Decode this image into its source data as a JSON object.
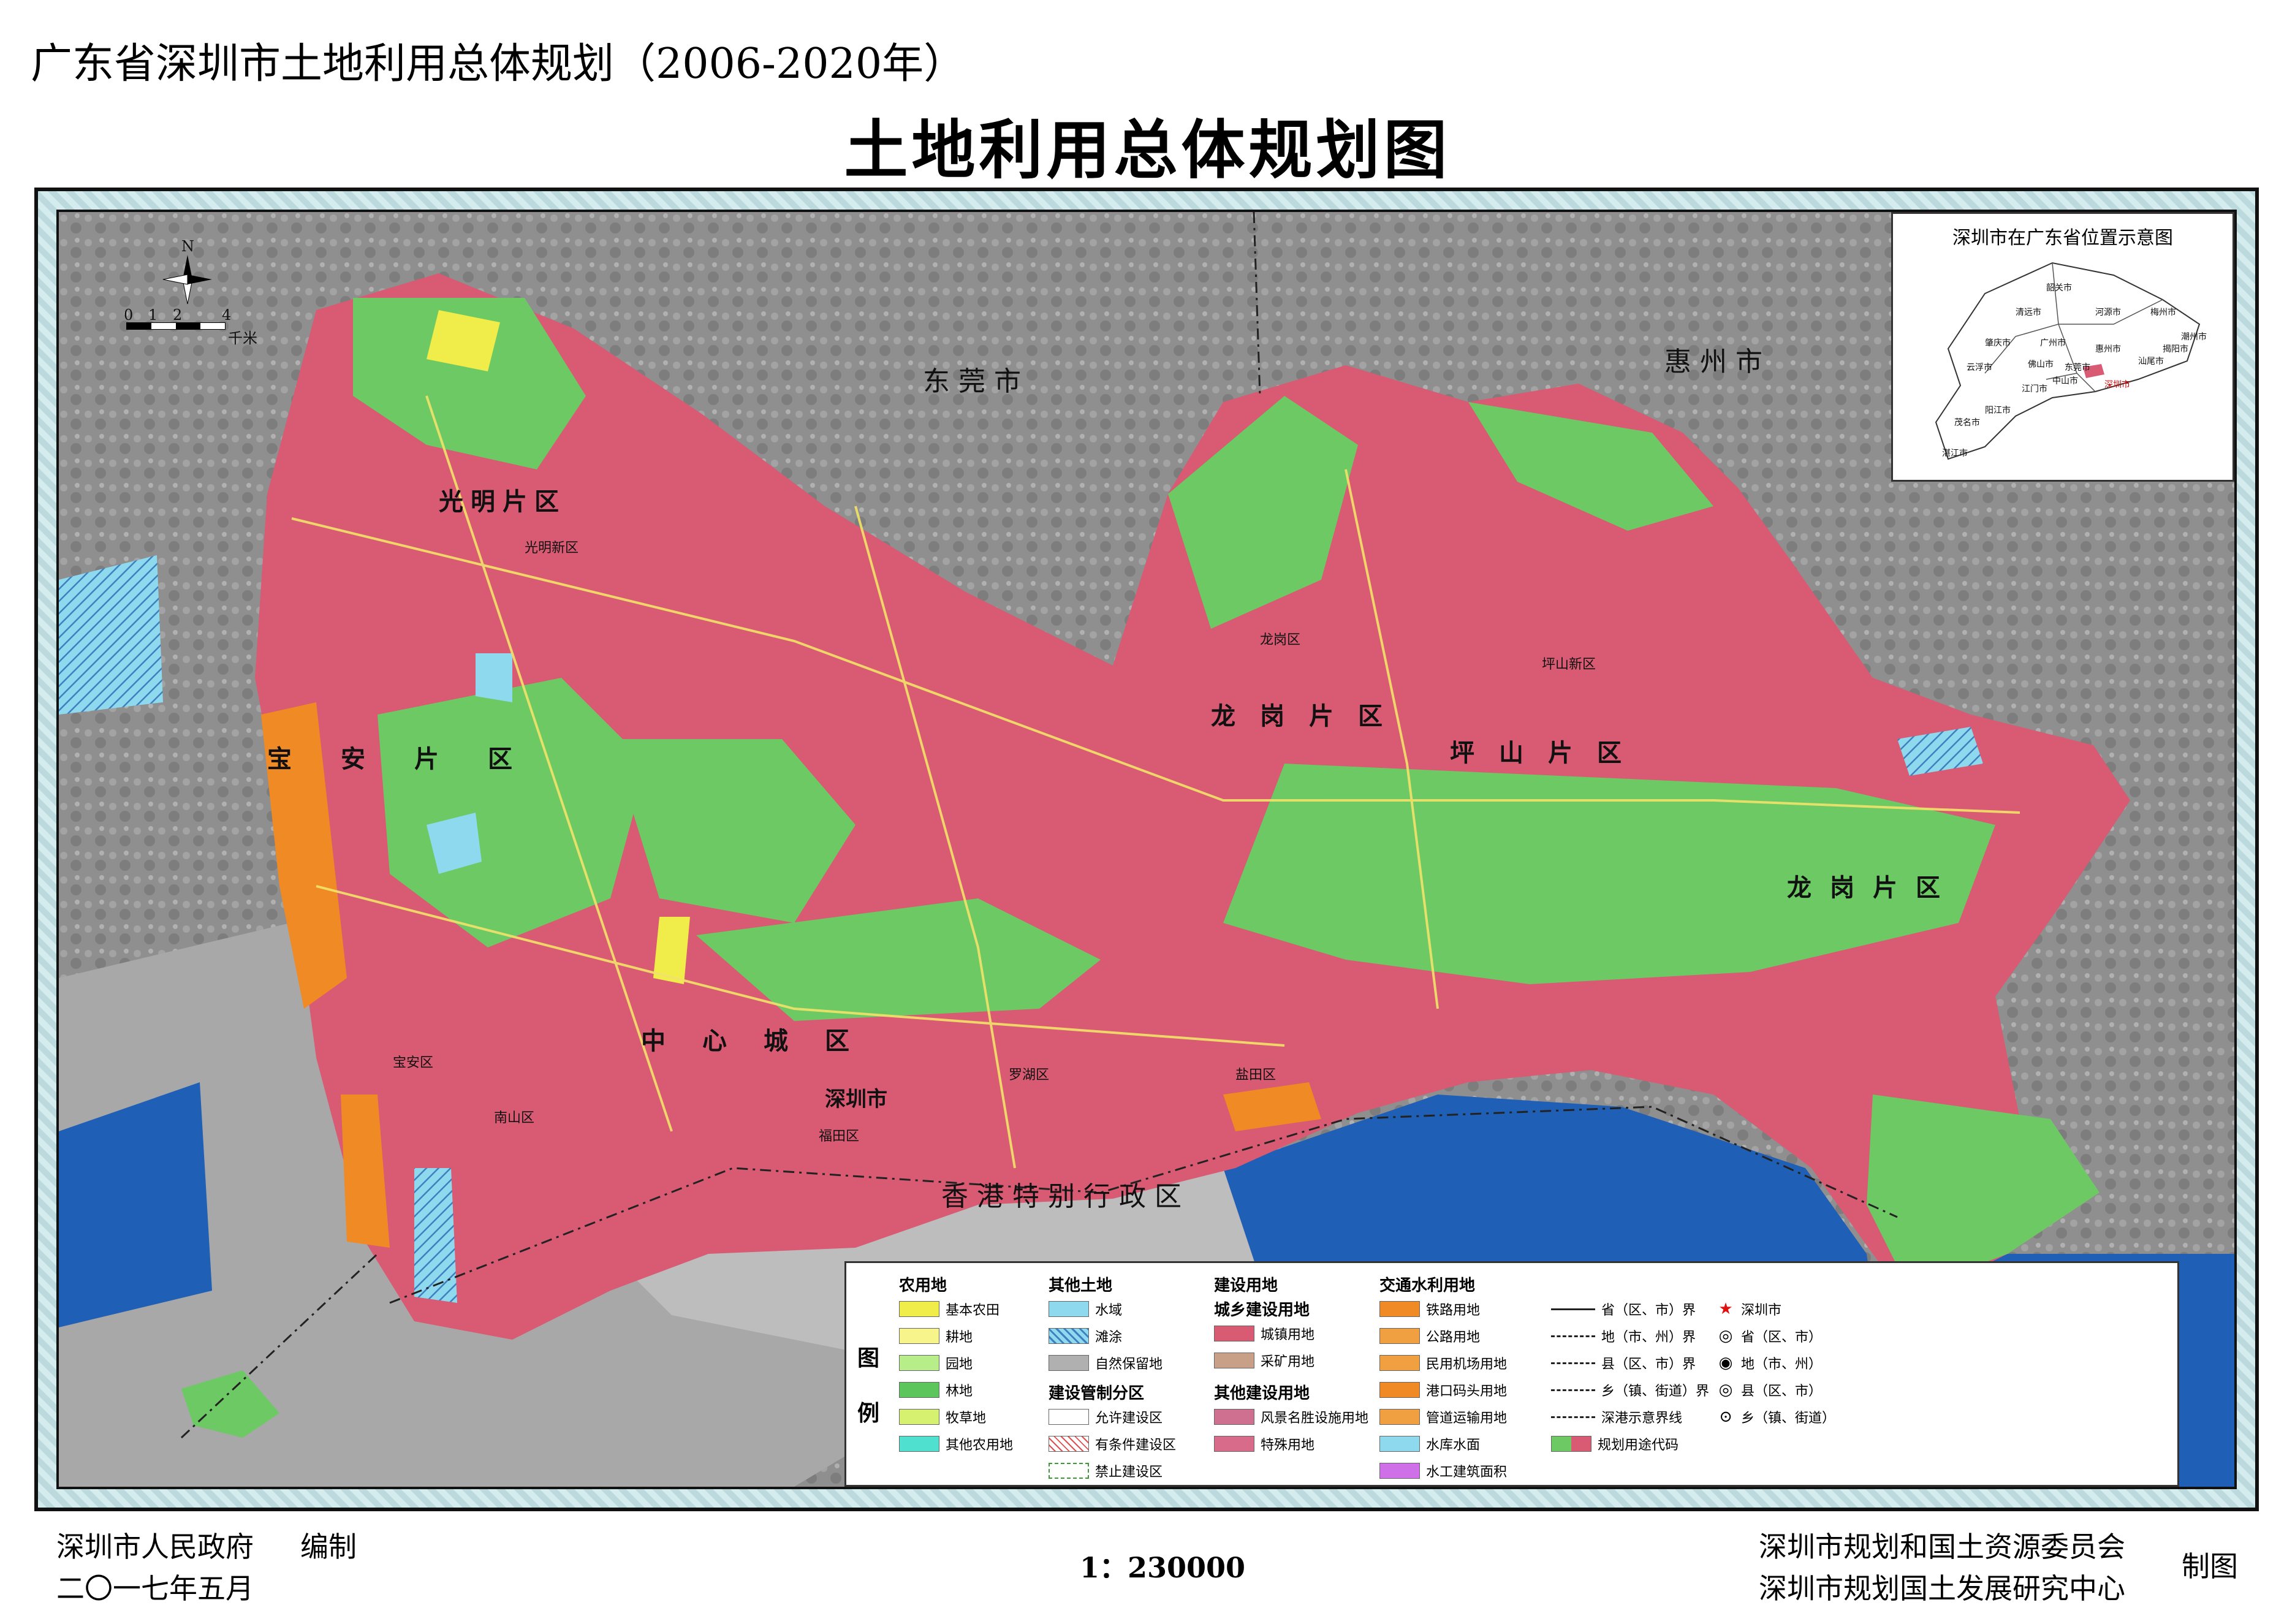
{
  "header": {
    "doc_title": "广东省深圳市土地利用总体规划（2006-2020年）",
    "map_title": "土地利用总体规划图"
  },
  "map": {
    "neighbors": {
      "dongguan": "东莞市",
      "huizhou": "惠州市",
      "hongkong": "香港特别行政区"
    },
    "districts": {
      "guangming": "光明片区",
      "baoan": "宝安片区",
      "longgang_north": "龙岗片区",
      "pingshan": "坪山片区",
      "center": "中心城区",
      "longgang_east": "龙岗片区"
    },
    "towns": {
      "guangming_new": "光明新区",
      "baoan_qu": "宝安区",
      "nanshan": "南山区",
      "futian": "福田区",
      "shenzhen": "深圳市",
      "luohu": "罗湖区",
      "yantian": "盐田区",
      "longgang_qu": "龙岗区",
      "pingshan_new": "坪山新区"
    },
    "compass": {
      "north": "N",
      "scale_ticks": [
        "0",
        "1",
        "2",
        "4"
      ],
      "scale_unit": "千米"
    },
    "colors": {
      "urban": "#d85a73",
      "forest": "#6cc964",
      "water": "#1f5fb5",
      "tideland": "#7ed3e6",
      "port": "#f08a24",
      "basic_farmland": "#f0ec4a",
      "background": "#8f8f8f"
    }
  },
  "inset": {
    "title": "深圳市在广东省位置示意图",
    "cities": [
      "韶关市",
      "清远市",
      "河源市",
      "梅州市",
      "潮州市",
      "肇庆市",
      "广州市",
      "惠州市",
      "汕尾市",
      "揭阳市",
      "云浮市",
      "佛山市",
      "东莞市",
      "深圳市",
      "江门市",
      "阳江市",
      "茂名市",
      "湛江市",
      "中山市"
    ]
  },
  "legend": {
    "side_label": [
      "图",
      "例"
    ],
    "groups": {
      "agri": {
        "title": "农用地",
        "items": [
          "基本农田",
          "耕地",
          "园地",
          "林地",
          "牧草地",
          "其他农用地"
        ],
        "colors": [
          "#f0ec4a",
          "#f6f48a",
          "#b8ee8a",
          "#5cc55c",
          "#d6f070",
          "#4fe0d0"
        ]
      },
      "other": {
        "title": "其他土地",
        "items": [
          "水域",
          "滩涂",
          "自然保留地"
        ],
        "colors": [
          "#8fd9ee",
          "#6fcde0",
          "#b0b0b0"
        ]
      },
      "zoning": {
        "title": "建设管制分区",
        "items": [
          "允许建设区",
          "有条件建设区",
          "禁止建设区"
        ]
      },
      "construction": {
        "title": "建设用地",
        "subtitle": "城乡建设用地",
        "items": [
          "城镇用地",
          "采矿用地"
        ],
        "colors": [
          "#d85a73",
          "#c8a088"
        ]
      },
      "other_construction": {
        "title": "其他建设用地",
        "items": [
          "风景名胜设施用地",
          "特殊用地"
        ],
        "colors": [
          "#d07090",
          "#d86a8a"
        ]
      },
      "transport": {
        "title": "交通水利用地",
        "items": [
          "铁路用地",
          "公路用地",
          "民用机场用地",
          "港口码头用地",
          "管道运输用地",
          "水库水面",
          "水工建筑面积"
        ],
        "colors": [
          "#f08a24",
          "#f0a040",
          "#f0a040",
          "#f08a24",
          "#f0a040",
          "#8fd9ee",
          "#d070e8"
        ]
      },
      "boundaries": {
        "items": [
          "省（区、市）界",
          "地（市、州）界",
          "县（区、市）界",
          "乡（镇、街道）界",
          "深港示意界线"
        ]
      },
      "symbols": {
        "items": [
          "深圳市",
          "省（区、市）",
          "地（市、州）",
          "县（区、市）",
          "乡（镇、街道）"
        ],
        "glyphs": [
          "★",
          "◎",
          "◉",
          "◎",
          "⊙"
        ]
      },
      "code_label": "规划用途代码"
    }
  },
  "footer": {
    "left_org": "深圳市人民政府",
    "left_action": "编制",
    "left_date": "二〇一七年五月",
    "scale": "1：230000",
    "right_org1": "深圳市规划和国土资源委员会",
    "right_org2": "深圳市规划国土发展研究中心",
    "right_action": "制图"
  }
}
